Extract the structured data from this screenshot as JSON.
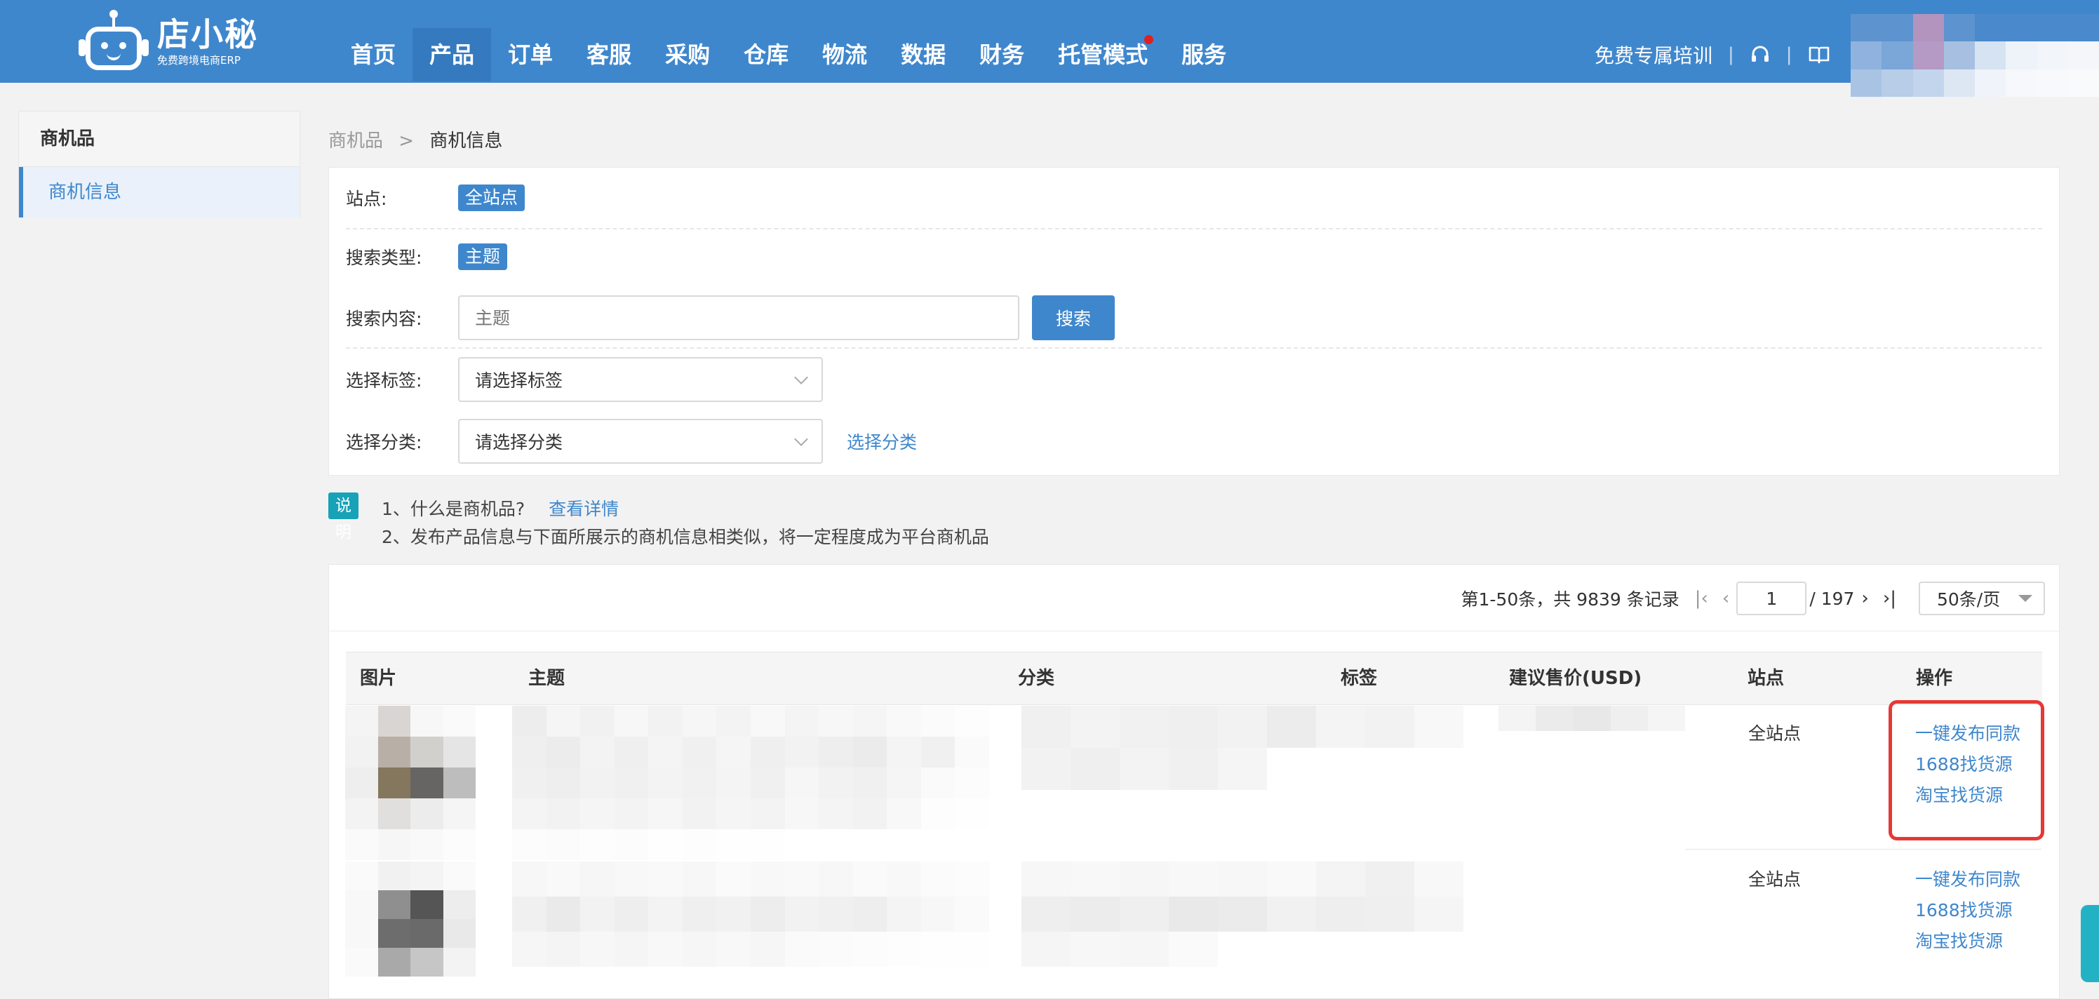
{
  "brand": {
    "name": "店小秘",
    "slogan": "免费跨境电商ERP"
  },
  "nav": [
    {
      "label": "首页"
    },
    {
      "label": "产品",
      "active": true
    },
    {
      "label": "订单"
    },
    {
      "label": "客服"
    },
    {
      "label": "采购"
    },
    {
      "label": "仓库"
    },
    {
      "label": "物流"
    },
    {
      "label": "数据"
    },
    {
      "label": "财务"
    },
    {
      "label": "托管模式",
      "dot": true
    },
    {
      "label": "服务"
    }
  ],
  "topright": {
    "training": "免费专属培训",
    "sep": "|",
    "icons": [
      "headset-icon",
      "book-icon"
    ]
  },
  "sidebar": {
    "title": "商机品",
    "items": [
      {
        "label": "商机信息",
        "active": true
      }
    ]
  },
  "breadcrumb": {
    "parent": "商机品",
    "separator": ">",
    "current": "商机信息"
  },
  "filters": {
    "site": {
      "label": "站点:",
      "value": "全站点"
    },
    "search_type": {
      "label": "搜索类型:",
      "value": "主题"
    },
    "search_content": {
      "label": "搜索内容:",
      "placeholder": "主题",
      "button": "搜索"
    },
    "tag": {
      "label": "选择标签:",
      "placeholder": "请选择标签"
    },
    "category": {
      "label": "选择分类:",
      "placeholder": "请选择分类",
      "link": "选择分类"
    }
  },
  "notes": {
    "badge": "说明",
    "line1": "1、什么是商机品?",
    "line1_link": "查看详情",
    "line2": "2、发布产品信息与下面所展示的商机信息相类似，将一定程度成为平台商机品"
  },
  "pagination": {
    "summary": "第1-50条，共 9839 条记录",
    "current_page": "1",
    "total_pages": "/ 197",
    "per_page": "50条/页"
  },
  "table": {
    "columns": [
      "图片",
      "主题",
      "分类",
      "标签",
      "建议售价(USD)",
      "站点",
      "操作"
    ],
    "rows": [
      {
        "site": "全站点",
        "actions": [
          "一键发布同款",
          "1688找货源",
          "淘宝找货源"
        ]
      },
      {
        "site": "全站点",
        "actions": [
          "一键发布同款",
          "1688找货源",
          "淘宝找货源"
        ]
      }
    ]
  },
  "colors": {
    "brand_blue": "#3f87cd",
    "highlight_red": "#e53935",
    "note_teal": "#17a2b8"
  }
}
